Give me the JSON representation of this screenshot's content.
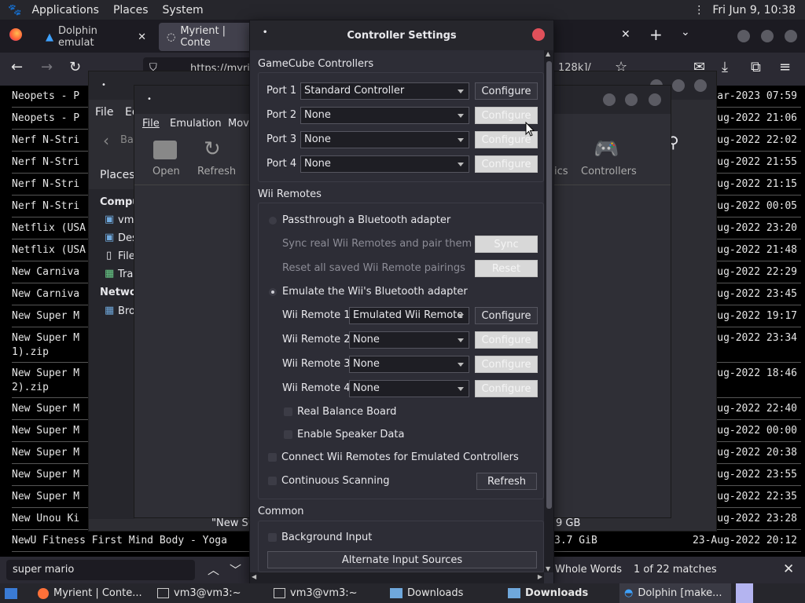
{
  "top_panel": {
    "menus": [
      "Applications",
      "Places",
      "System"
    ],
    "clock": "Fri Jun  9, 10:38"
  },
  "firefox": {
    "tabs": [
      "Dolphin emulat",
      "Myrient | Conte"
    ],
    "url": "https://myri",
    "url_tail": "128k]/",
    "rows": [
      {
        "name": "Neopets - P",
        "date": "ar-2023 07:59"
      },
      {
        "name": "Neopets - P",
        "date": "Aug-2022 21:06"
      },
      {
        "name": "Nerf N-Stri",
        "date": "Aug-2022 22:02"
      },
      {
        "name": "Nerf N-Stri",
        "date": "Aug-2022 21:55"
      },
      {
        "name": "Nerf N-Stri",
        "date": "Aug-2022 21:15"
      },
      {
        "name": "Nerf N-Stri",
        "date": "Aug-2022 00:05"
      },
      {
        "name": "Netflix (USA",
        "date": "Aug-2022 23:20"
      },
      {
        "name": "Netflix (USA",
        "date": "Aug-2022 21:48"
      },
      {
        "name": "New Carniva",
        "date": "Aug-2022 22:29"
      },
      {
        "name": "New Carniva",
        "date": "Aug-2022 23:45"
      },
      {
        "name": "New Super M",
        "date": "Aug-2022 19:17"
      },
      {
        "name": "New Super M",
        "name2": "1).zip",
        "date": "Aug-2022 23:34"
      },
      {
        "name": "New Super M",
        "name2": "2).zip",
        "date": "Aug-2022 18:46"
      },
      {
        "name": "New Super M",
        "date": "Aug-2022 22:40"
      },
      {
        "name": "New Super M",
        "date": "Aug-2022 00:00"
      },
      {
        "name": "New Super M",
        "date": "Aug-2022 20:38"
      },
      {
        "name": "New Super M",
        "date": "Aug-2022 23:55"
      },
      {
        "name": "New Super M",
        "date": "Aug-2022 22:35"
      },
      {
        "name": "New Unou Ki",
        "date": "Aug-2022 23:28"
      },
      {
        "name": "NewU Fitness First Mind Body - Yoga",
        "size": "3.7 GiB",
        "date": "23-Aug-2022 20:12"
      }
    ],
    "findbar": {
      "query": "super mario",
      "whole_words": "Whole Words",
      "matches": "1 of 22 matches"
    }
  },
  "nautilus": {
    "menus": [
      "File",
      "Ed"
    ],
    "back": "Ba",
    "places": "Places",
    "computer": "Compu",
    "items": [
      "vm3",
      "Des",
      "File",
      "Tra"
    ],
    "network": "Networ",
    "net_items": [
      "Bro"
    ],
    "status": "\"New Su",
    "size": "9 GB"
  },
  "dolphin": {
    "menus": [
      "File",
      "Emulation",
      "Movi"
    ],
    "toolbar": [
      "Open",
      "Refresh"
    ],
    "toolbar_right": [
      "ics",
      "Controllers"
    ]
  },
  "dialog": {
    "title": "Controller Settings",
    "gc_header": "GameCube Controllers",
    "ports": [
      {
        "label": "Port 1",
        "value": "Standard Controller",
        "btn": "Configure"
      },
      {
        "label": "Port 2",
        "value": "None",
        "btn": "Configure"
      },
      {
        "label": "Port 3",
        "value": "None",
        "btn": "Configure"
      },
      {
        "label": "Port 4",
        "value": "None",
        "btn": "Configure"
      }
    ],
    "wii_header": "Wii Remotes",
    "passthrough": "Passthrough a Bluetooth adapter",
    "sync_label": "Sync real Wii Remotes and pair them",
    "sync_btn": "Sync",
    "reset_label": "Reset all saved Wii Remote pairings",
    "reset_btn": "Reset",
    "emulate": "Emulate the Wii's Bluetooth adapter",
    "remotes": [
      {
        "label": "Wii Remote 1",
        "value": "Emulated Wii Remote",
        "btn": "Configure"
      },
      {
        "label": "Wii Remote 2",
        "value": "None",
        "btn": "Configure"
      },
      {
        "label": "Wii Remote 3",
        "value": "None",
        "btn": "Configure"
      },
      {
        "label": "Wii Remote 4",
        "value": "None",
        "btn": "Configure"
      }
    ],
    "balance": "Real Balance Board",
    "speaker": "Enable Speaker Data",
    "connect": "Connect Wii Remotes for Emulated Controllers",
    "scanning": "Continuous Scanning",
    "refresh_btn": "Refresh",
    "common_header": "Common",
    "background_input": "Background Input",
    "alt_sources": "Alternate Input Sources"
  },
  "taskbar": {
    "items": [
      "Myrient | Conte...",
      "vm3@vm3:~",
      "vm3@vm3:~",
      "Downloads",
      "Downloads",
      "Dolphin [make..."
    ]
  }
}
